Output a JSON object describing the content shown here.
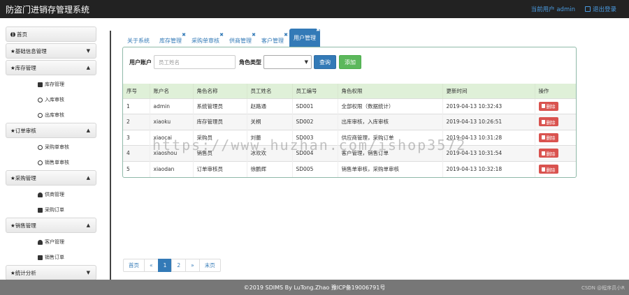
{
  "app": {
    "title": "防盗门进销存管理系统",
    "current_user": "当前用户 admin",
    "logout": "退出登录"
  },
  "sidebar": {
    "groups": [
      {
        "label": "首页",
        "sub": []
      },
      {
        "label": "★基础信息管理",
        "sub": []
      },
      {
        "label": "★库存管理",
        "sub": [
          "库存管理",
          "入库审核",
          "出库审核"
        ]
      },
      {
        "label": "★订单审核",
        "sub": [
          "采购单审核",
          "销售单审核"
        ]
      },
      {
        "label": "★采购管理",
        "sub": [
          "供商管理",
          "采购订单"
        ]
      },
      {
        "label": "★销售管理",
        "sub": [
          "客户管理",
          "销售订单"
        ]
      },
      {
        "label": "★统计分析",
        "sub": []
      }
    ]
  },
  "tabs": [
    {
      "label": "关于系统",
      "closable": false
    },
    {
      "label": "库存管理",
      "closable": true
    },
    {
      "label": "采购单审核",
      "closable": true
    },
    {
      "label": "供商管理",
      "closable": true
    },
    {
      "label": "客户管理",
      "closable": true
    },
    {
      "label": "用户管理",
      "closable": true,
      "active": true
    }
  ],
  "search": {
    "account_label": "用户账户",
    "account_placeholder": "员工姓名",
    "role_label": "角色类型",
    "query_button": "查询",
    "add_button": "添加"
  },
  "table": {
    "headers": [
      "序号",
      "账户名",
      "角色名称",
      "员工姓名",
      "员工编号",
      "角色权限",
      "更新时间",
      "操作"
    ],
    "rows": [
      [
        "1",
        "admin",
        "系统管理员",
        "赵路通",
        "SD001",
        "全部权限（数据统计）",
        "2019-04-13 10:32:43"
      ],
      [
        "2",
        "xiaoku",
        "库存管理员",
        "关桐",
        "SD002",
        "出库审核，入库审核",
        "2019-04-13 10:26:51"
      ],
      [
        "3",
        "xiaocai",
        "采购员",
        "刘蕾",
        "SD003",
        "供应商管理，采购订单",
        "2019-04-13 10:31:28"
      ],
      [
        "4",
        "xiaoshou",
        "销售员",
        "冰欢欢",
        "SD004",
        "客户管理，销售订单",
        "2019-04-13 10:31:54"
      ],
      [
        "5",
        "xiaodan",
        "订单审核员",
        "徐鹏辉",
        "SD005",
        "销售单审核，采购单审核",
        "2019-04-13 10:32:18"
      ]
    ],
    "delete_label": "删除"
  },
  "pagination": [
    "首页",
    "«",
    "1",
    "2",
    "»",
    "末页"
  ],
  "pagination_active": "1",
  "footer": "©2019 SDIMS By LuTong.Zhao 豫ICP备19006791号",
  "csdn": "CSDN @程序员小R",
  "watermark": "https://www.huzhan.com/ishop3572",
  "colors": {
    "primary": "#337ab7",
    "success": "#5cb85c",
    "danger": "#d9534f",
    "header_row": "#dff0d8"
  }
}
